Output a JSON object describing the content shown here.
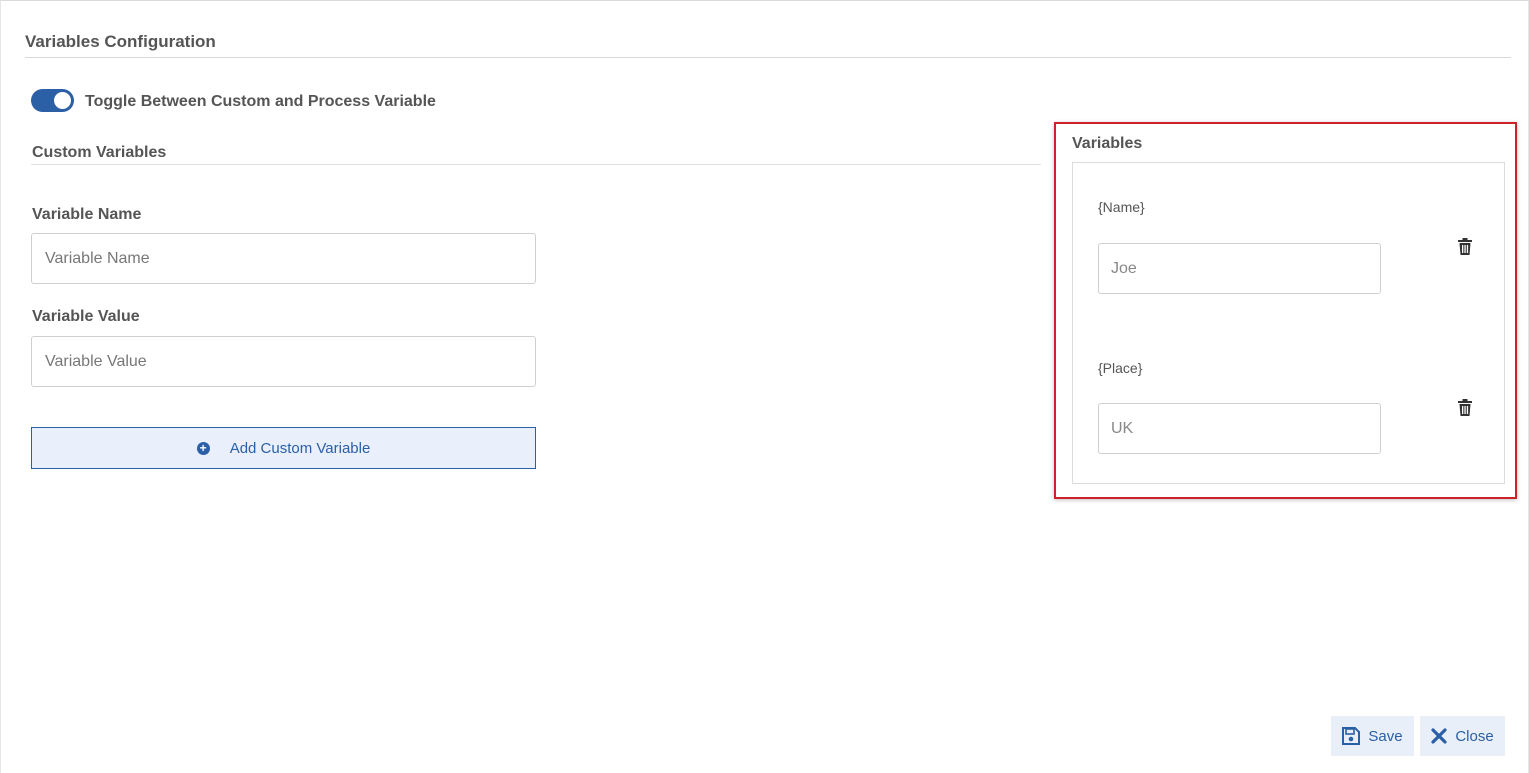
{
  "page": {
    "title": "Variables Configuration"
  },
  "toggle": {
    "label": "Toggle Between Custom and Process Variable",
    "on": true
  },
  "custom_variables": {
    "section_title": "Custom Variables",
    "name_label": "Variable Name",
    "name_placeholder": "Variable Name",
    "value_label": "Variable Value",
    "value_placeholder": "Variable Value",
    "add_button_label": "Add Custom Variable"
  },
  "variables_panel": {
    "title": "Variables",
    "items": [
      {
        "key": "{Name}",
        "placeholder": "Joe"
      },
      {
        "key": "{Place}",
        "placeholder": "UK"
      }
    ]
  },
  "footer": {
    "save_label": "Save",
    "close_label": "Close"
  },
  "colors": {
    "accent": "#2b5fa6",
    "highlight_border": "#d0202a"
  }
}
